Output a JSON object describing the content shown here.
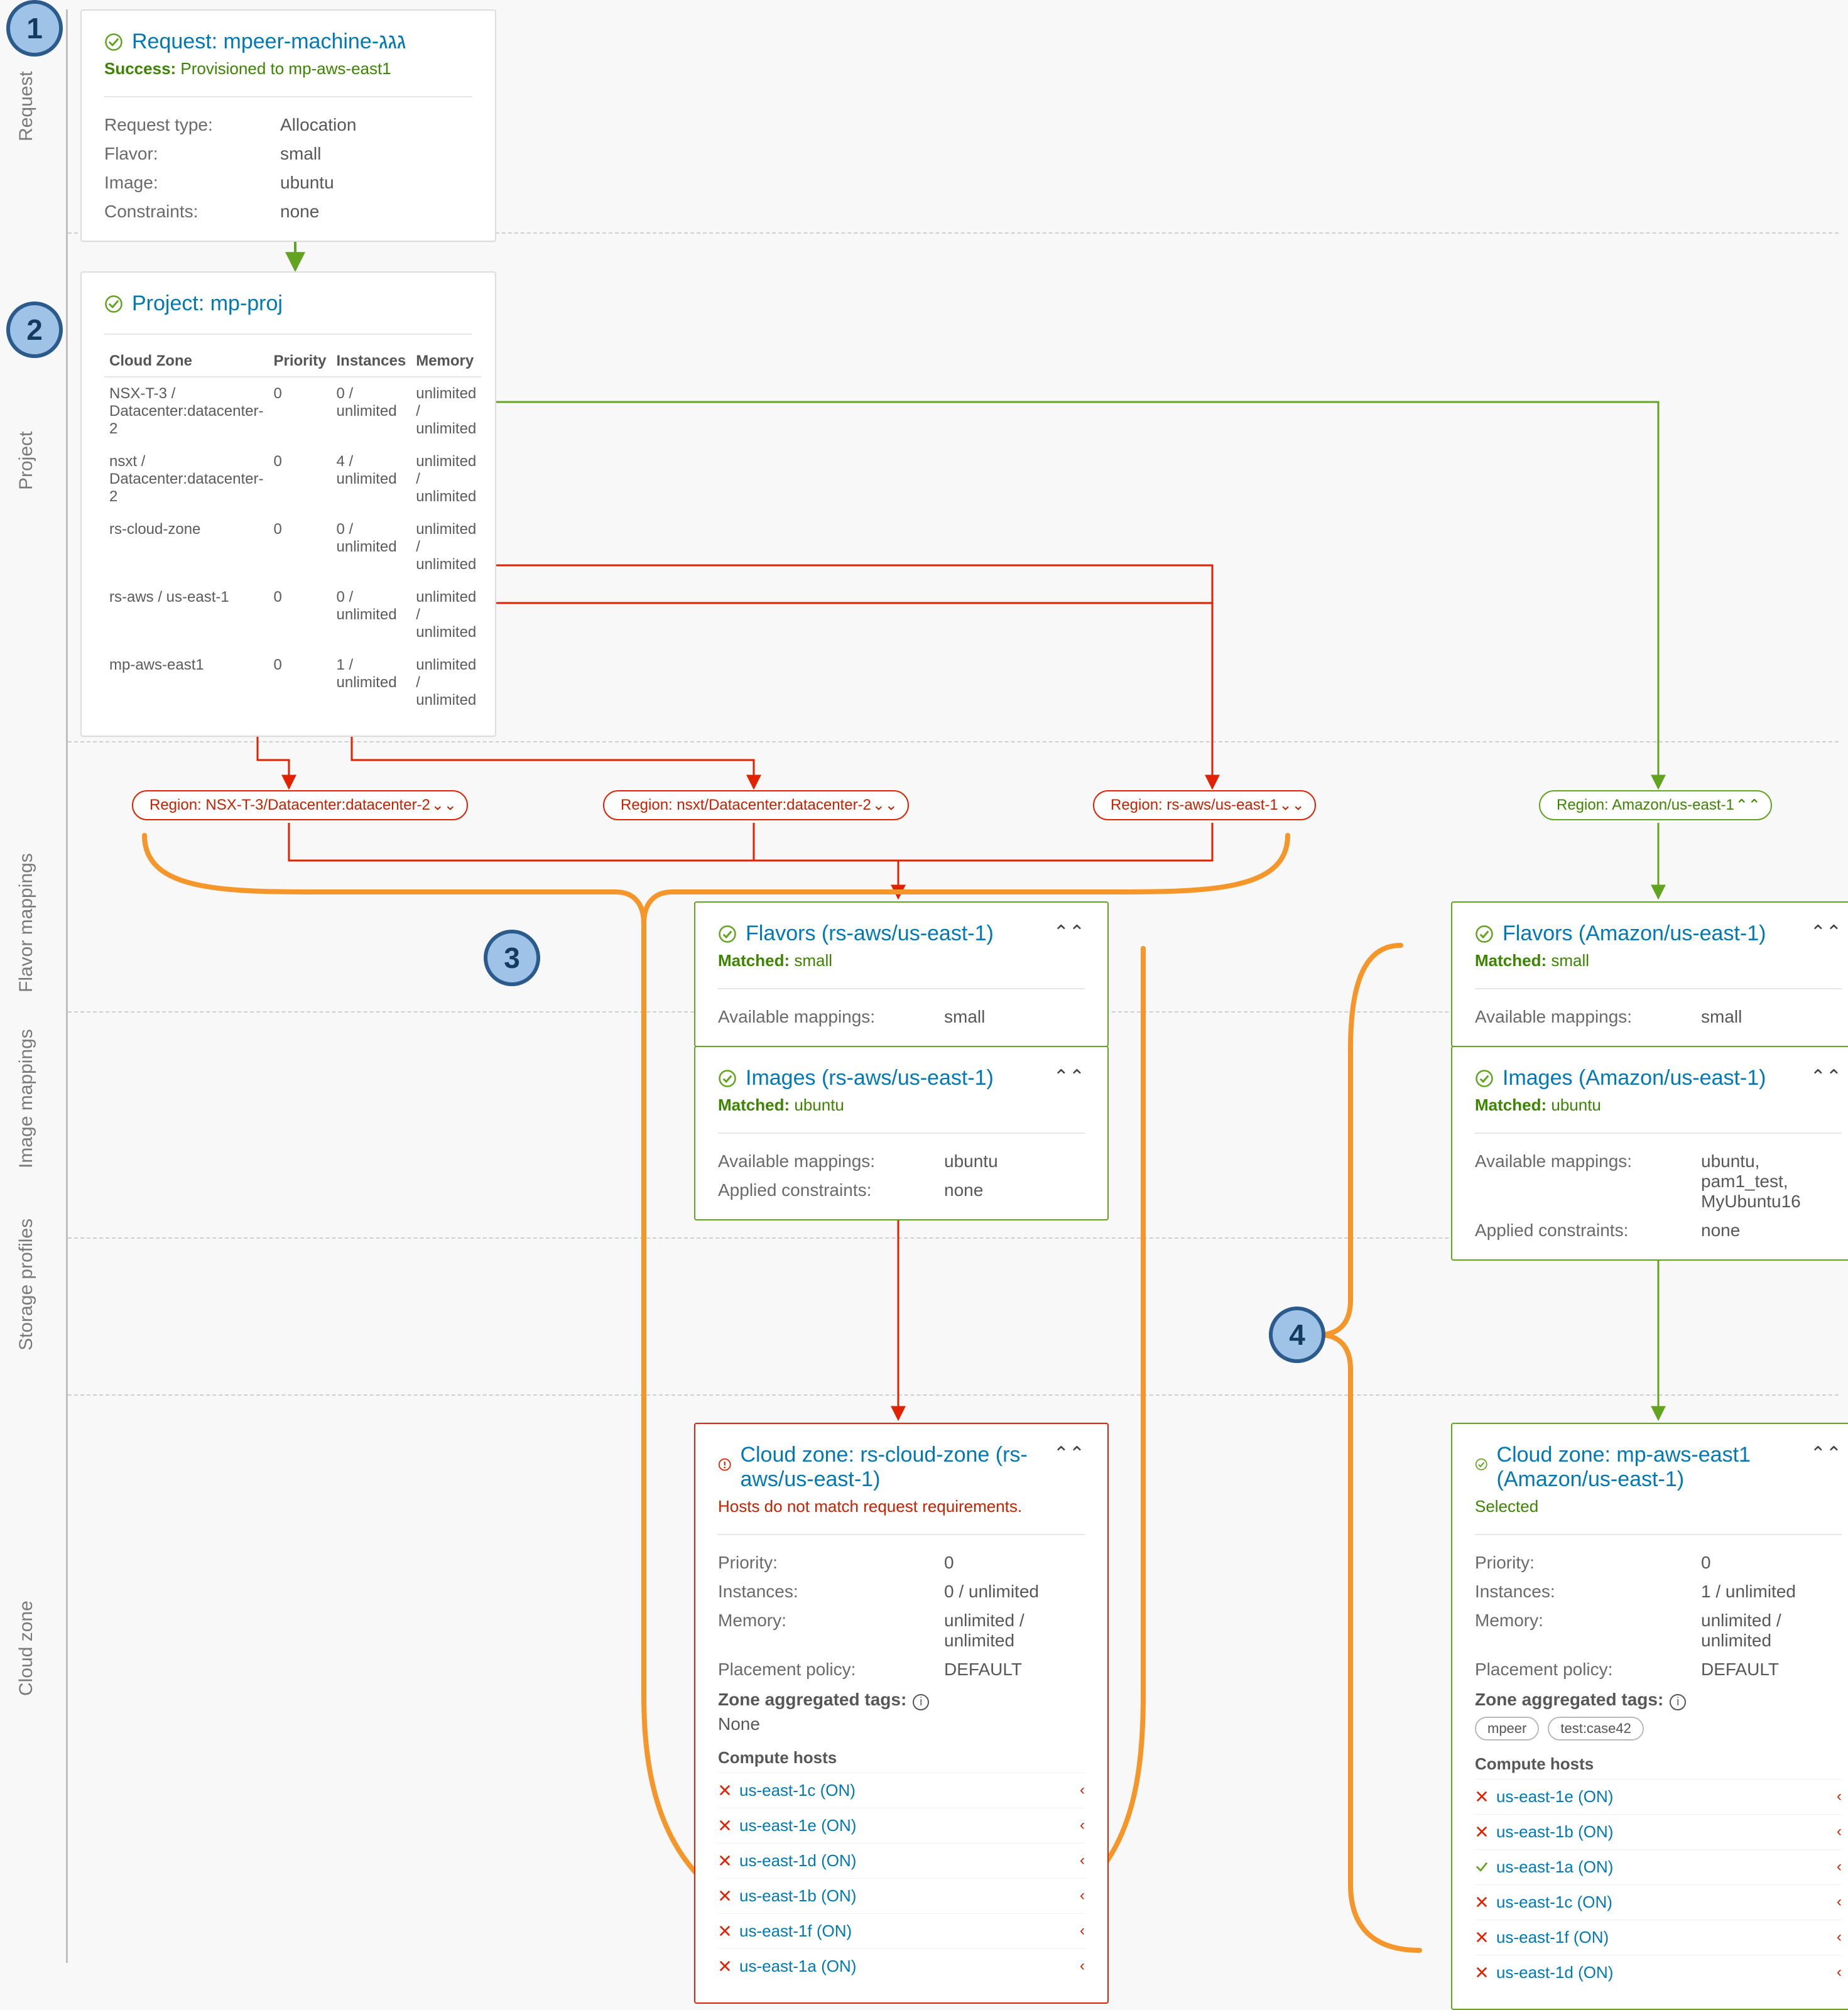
{
  "sections": {
    "request": "Request",
    "project": "Project",
    "flavor": "Flavor mappings",
    "image": "Image mappings",
    "storage": "Storage profiles",
    "cloud_zone": "Cloud zone"
  },
  "request": {
    "title": "Request: mpeer-machine-גגג",
    "status_label": "Success:",
    "status_text": "Provisioned to mp-aws-east1",
    "fields": {
      "request_type_label": "Request type:",
      "request_type": "Allocation",
      "flavor_label": "Flavor:",
      "flavor": "small",
      "image_label": "Image:",
      "image": "ubuntu",
      "constraints_label": "Constraints:",
      "constraints": "none"
    }
  },
  "project": {
    "title": "Project: mp-proj",
    "headers": {
      "zone": "Cloud Zone",
      "priority": "Priority",
      "instances": "Instances",
      "memory": "Memory"
    },
    "rows": [
      {
        "zone": "NSX-T-3 / Datacenter:datacenter-2",
        "priority": "0",
        "instances": "0 / unlimited",
        "memory": "unlimited / unlimited"
      },
      {
        "zone": "nsxt / Datacenter:datacenter-2",
        "priority": "0",
        "instances": "4 / unlimited",
        "memory": "unlimited / unlimited"
      },
      {
        "zone": "rs-cloud-zone",
        "priority": "0",
        "instances": "0 / unlimited",
        "memory": "unlimited / unlimited"
      },
      {
        "zone": "rs-aws / us-east-1",
        "priority": "0",
        "instances": "0 / unlimited",
        "memory": "unlimited / unlimited"
      },
      {
        "zone": "mp-aws-east1",
        "priority": "0",
        "instances": "1 / unlimited",
        "memory": "unlimited / unlimited"
      }
    ]
  },
  "regions": {
    "r1": "Region: NSX-T-3/Datacenter:datacenter-2",
    "r2": "Region: nsxt/Datacenter:datacenter-2",
    "r3": "Region: rs-aws/us-east-1",
    "r4": "Region: Amazon/us-east-1"
  },
  "flavors": {
    "rs": {
      "title": "Flavors (rs-aws/us-east-1)",
      "matched_label": "Matched:",
      "matched": "small",
      "avail_label": "Available mappings:",
      "avail": "small"
    },
    "az": {
      "title": "Flavors (Amazon/us-east-1)",
      "matched_label": "Matched:",
      "matched": "small",
      "avail_label": "Available mappings:",
      "avail": "small"
    }
  },
  "images": {
    "rs": {
      "title": "Images (rs-aws/us-east-1)",
      "matched_label": "Matched:",
      "matched": "ubuntu",
      "avail_label": "Available mappings:",
      "avail": "ubuntu",
      "constraints_label": "Applied constraints:",
      "constraints": "none"
    },
    "az": {
      "title": "Images (Amazon/us-east-1)",
      "matched_label": "Matched:",
      "matched": "ubuntu",
      "avail_label": "Available mappings:",
      "avail": "ubuntu, pam1_test, MyUbuntu16",
      "constraints_label": "Applied constraints:",
      "constraints": "none"
    }
  },
  "cloud_zones": {
    "rs": {
      "title": "Cloud zone: rs-cloud-zone (rs-aws/us-east-1)",
      "status": "Hosts do not match request requirements.",
      "labels": {
        "priority": "Priority:",
        "instances": "Instances:",
        "memory": "Memory:",
        "policy": "Placement policy:",
        "tags": "Zone aggregated tags:",
        "hosts": "Compute hosts"
      },
      "priority": "0",
      "instances": "0 / unlimited",
      "memory": "unlimited / unlimited",
      "policy": "DEFAULT",
      "tags_none": "None",
      "hosts": [
        {
          "name": "us-east-1c (ON)",
          "ok": false
        },
        {
          "name": "us-east-1e (ON)",
          "ok": false
        },
        {
          "name": "us-east-1d (ON)",
          "ok": false
        },
        {
          "name": "us-east-1b (ON)",
          "ok": false
        },
        {
          "name": "us-east-1f (ON)",
          "ok": false
        },
        {
          "name": "us-east-1a (ON)",
          "ok": false
        }
      ]
    },
    "az": {
      "title": "Cloud zone: mp-aws-east1 (Amazon/us-east-1)",
      "status": "Selected",
      "labels": {
        "priority": "Priority:",
        "instances": "Instances:",
        "memory": "Memory:",
        "policy": "Placement policy:",
        "tags": "Zone aggregated tags:",
        "hosts": "Compute hosts"
      },
      "priority": "0",
      "instances": "1 / unlimited",
      "memory": "unlimited / unlimited",
      "policy": "DEFAULT",
      "tags": [
        "mpeer",
        "test:case42"
      ],
      "hosts": [
        {
          "name": "us-east-1e (ON)",
          "ok": false
        },
        {
          "name": "us-east-1b (ON)",
          "ok": false
        },
        {
          "name": "us-east-1a (ON)",
          "ok": true
        },
        {
          "name": "us-east-1c (ON)",
          "ok": false
        },
        {
          "name": "us-east-1f (ON)",
          "ok": false
        },
        {
          "name": "us-east-1d (ON)",
          "ok": false
        }
      ]
    }
  },
  "badges": {
    "b1": "1",
    "b2": "2",
    "b3": "3",
    "b4": "4"
  }
}
